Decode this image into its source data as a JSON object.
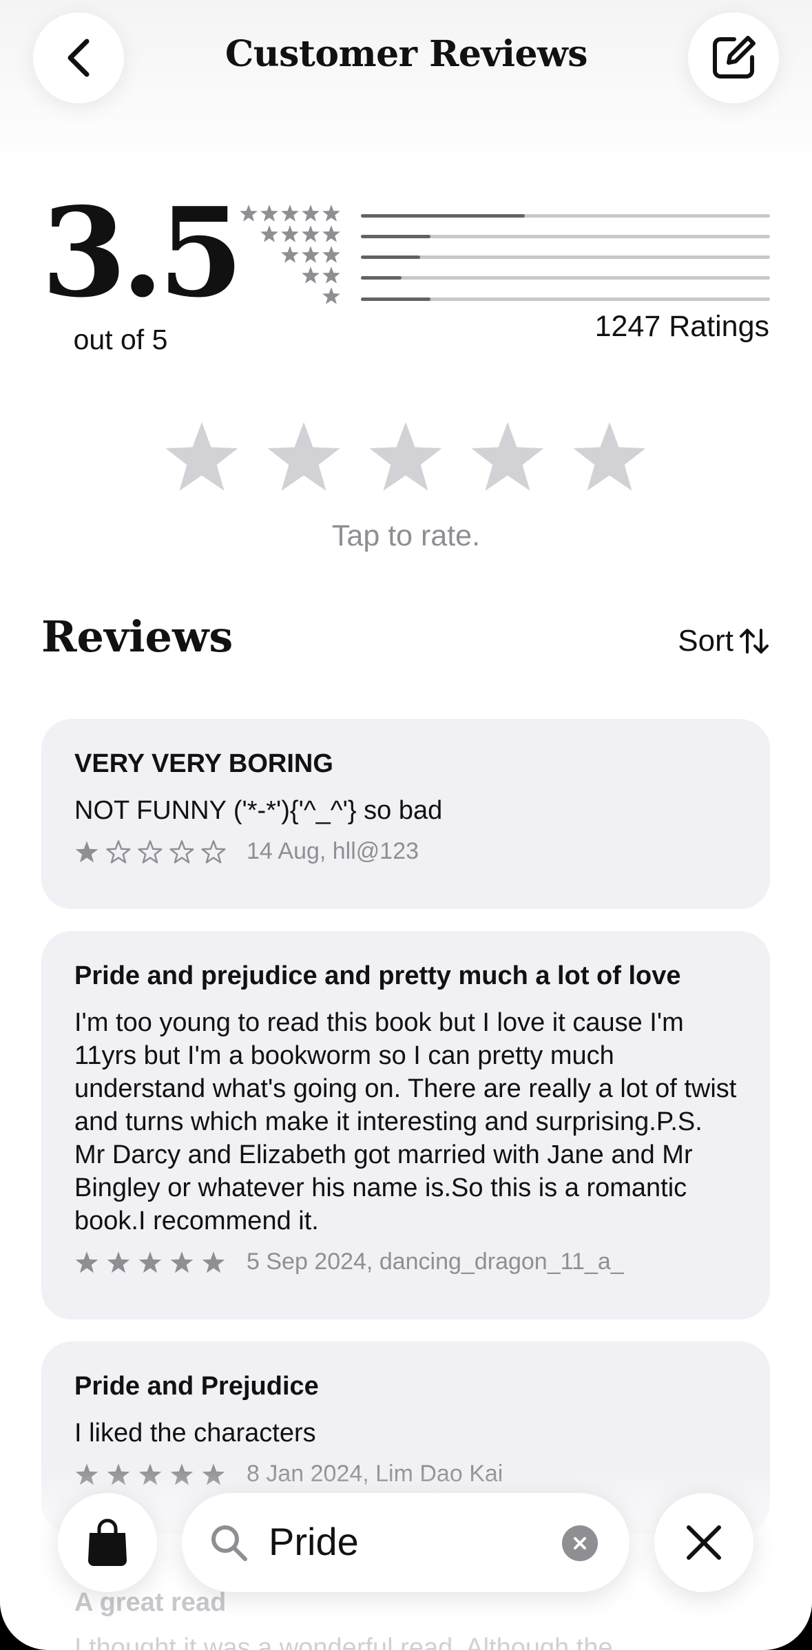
{
  "header": {
    "title": "Customer Reviews",
    "back_icon": "chevron-left-icon",
    "compose_icon": "compose-icon"
  },
  "summary": {
    "score": "3.5",
    "out_of": "out of 5",
    "ratings_count": "1247 Ratings",
    "distribution": [
      {
        "stars": 5,
        "fraction": 0.4
      },
      {
        "stars": 4,
        "fraction": 0.17
      },
      {
        "stars": 3,
        "fraction": 0.145
      },
      {
        "stars": 2,
        "fraction": 0.1
      },
      {
        "stars": 1,
        "fraction": 0.17
      }
    ]
  },
  "rate": {
    "prompt": "Tap to rate.",
    "star_count": 5
  },
  "reviews_section": {
    "heading": "Reviews",
    "sort_label": "Sort",
    "sort_icon": "arrow-up-down-icon"
  },
  "reviews": [
    {
      "title": "VERY VERY BORING",
      "body": "NOT FUNNY ('*-*'){'^_^'} so bad",
      "rating": 1,
      "meta": "14 Aug, hll@123"
    },
    {
      "title": "Pride and prejudice and pretty much a lot of love",
      "body": "I'm too young to read this book but I love it cause I'm 11yrs but I'm a bookworm so I can pretty much understand what's going on. There are really a lot of twist and turns which make it interesting and surprising.P.S. Mr Darcy and Elizabeth got married with Jane and Mr Bingley or whatever his name is.So this is a romantic book.I recommend it.",
      "rating": 5,
      "meta": "5 Sep 2024, dancing_dragon_11_a_"
    },
    {
      "title": "Pride and Prejudice",
      "body": "I liked the characters",
      "rating": 5,
      "meta": "8 Jan 2024, Lim Dao Kai"
    },
    {
      "title": "A great read",
      "body": "I thought it was a wonderful read. Although the"
    }
  ],
  "bottom_bar": {
    "store_icon": "shopping-bag-icon",
    "search_icon": "search-icon",
    "search_value": "Pride",
    "clear_icon": "clear-circle-icon",
    "close_icon": "close-icon"
  },
  "colors": {
    "star_filled": "#8e8e93",
    "star_empty_tap": "#d1d1d6",
    "card_bg": "#f0f0f5",
    "bar_fill": "#636366",
    "bar_track": "#c7c7cc"
  }
}
